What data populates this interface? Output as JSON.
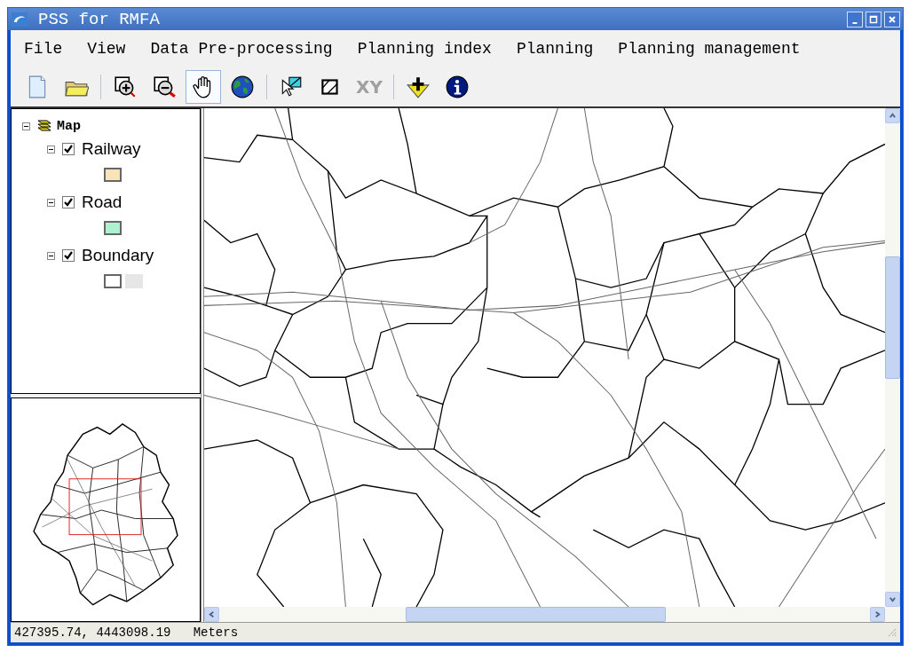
{
  "window": {
    "title": "PSS for RMFA"
  },
  "menu": [
    "File",
    "View",
    "Data Pre-processing",
    "Planning index",
    "Planning",
    "Planning management"
  ],
  "toolbar": [
    {
      "kind": "new",
      "selected": false,
      "disabled": false
    },
    {
      "kind": "open",
      "selected": false,
      "disabled": false
    },
    {
      "kind": "sep"
    },
    {
      "kind": "zoom-in",
      "selected": false,
      "disabled": false
    },
    {
      "kind": "zoom-out",
      "selected": false,
      "disabled": false
    },
    {
      "kind": "pan",
      "selected": true,
      "disabled": false
    },
    {
      "kind": "globe",
      "selected": false,
      "disabled": false
    },
    {
      "kind": "sep"
    },
    {
      "kind": "select",
      "selected": false,
      "disabled": false
    },
    {
      "kind": "extent",
      "selected": false,
      "disabled": false
    },
    {
      "kind": "text",
      "label": "XY",
      "selected": false,
      "disabled": true
    },
    {
      "kind": "sep"
    },
    {
      "kind": "add",
      "selected": false,
      "disabled": false
    },
    {
      "kind": "info",
      "selected": false,
      "disabled": false
    }
  ],
  "legend": {
    "label": "Map",
    "expanded": true,
    "children": [
      {
        "label": "Railway",
        "expanded": true,
        "checked": true,
        "swatches": [
          {
            "kind": "outlined",
            "color": "#f9e3b8"
          }
        ]
      },
      {
        "label": "Road",
        "expanded": true,
        "checked": true,
        "swatches": [
          {
            "kind": "outlined",
            "color": "#aef0d0"
          }
        ]
      },
      {
        "label": "Boundary",
        "expanded": true,
        "checked": true,
        "swatches": [
          {
            "kind": "outlined",
            "color": "#ffffff"
          },
          {
            "kind": "plain",
            "color": "#e6e6e6"
          }
        ]
      }
    ]
  },
  "status_bar": {
    "coordinates": "427395.74, 4443098.19   Meters"
  }
}
